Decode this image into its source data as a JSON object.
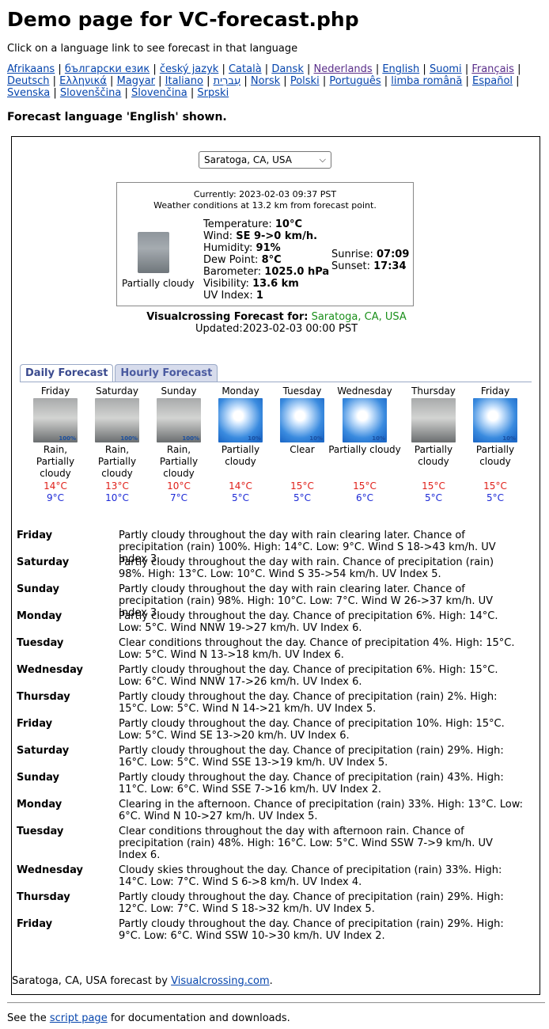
{
  "page": {
    "title": "Demo page for VC-forecast.php",
    "intro": "Click on a language link to see forecast in that language",
    "shown": "Forecast language 'English' shown."
  },
  "languages": [
    "Afrikaans",
    "български език",
    "český jazyk",
    "Català",
    "Dansk",
    "Nederlands",
    "English",
    "Suomi",
    "Français",
    "Deutsch",
    "Ελληνικά",
    "Magyar",
    "Italiano",
    "עִברִית",
    "Norsk",
    "Polski",
    "Português",
    "limba română",
    "Español",
    "Svenska",
    "Slovenščina",
    "Slovenčina",
    "Srpski"
  ],
  "location_select": {
    "value": "Saratoga, CA, USA"
  },
  "current": {
    "time_line": "Currently: 2023-02-03 09:37 PST",
    "distance_line": "Weather conditions at 13.2 km from forecast point.",
    "condition": "Partially cloudy",
    "temperature_label": "Temperature:",
    "temperature": "10°C",
    "wind_label": "Wind:",
    "wind": "SE 9->0 km/h.",
    "humidity_label": "Humidity:",
    "humidity": "91%",
    "dewpoint_label": "Dew Point:",
    "dewpoint": "8°C",
    "barometer_label": "Barometer:",
    "barometer": "1025.0 hPa",
    "visibility_label": "Visibility:",
    "visibility": "13.6 km",
    "uv_label": "UV Index:",
    "uv": "1",
    "sunrise_label": "Sunrise:",
    "sunrise": "07:09",
    "sunset_label": "Sunset:",
    "sunset": "17:34"
  },
  "forecast_for": {
    "label": "Visualcrossing Forecast for:",
    "location": "Saratoga, CA, USA",
    "updated": "Updated:2023-02-03 00:00 PST"
  },
  "tabs": {
    "daily": "Daily Forecast",
    "hourly": "Hourly Forecast"
  },
  "days": [
    {
      "name": "Friday",
      "icon": "rain-icon",
      "pct": "100%",
      "cond": "Rain, Partially cloudy",
      "hi": "14°C",
      "lo": "9°C"
    },
    {
      "name": "Saturday",
      "icon": "rain-icon",
      "pct": "100%",
      "cond": "Rain, Partially cloudy",
      "hi": "13°C",
      "lo": "10°C"
    },
    {
      "name": "Sunday",
      "icon": "rain-icon",
      "pct": "100%",
      "cond": "Rain, Partially cloudy",
      "hi": "10°C",
      "lo": "7°C"
    },
    {
      "name": "Monday",
      "icon": "sun-icon",
      "pct": "10%",
      "cond": "Partially cloudy",
      "hi": "14°C",
      "lo": "5°C"
    },
    {
      "name": "Tuesday",
      "icon": "sun-icon",
      "pct": "10%",
      "cond": "Clear",
      "hi": "15°C",
      "lo": "5°C"
    },
    {
      "name": "Wednesday",
      "icon": "sun-icon",
      "pct": "10%",
      "cond": "Partially cloudy",
      "hi": "15°C",
      "lo": "6°C"
    },
    {
      "name": "Thursday",
      "icon": "rain-icon",
      "pct": "",
      "cond": "Partially cloudy",
      "hi": "15°C",
      "lo": "5°C"
    },
    {
      "name": "Friday",
      "icon": "sun-icon",
      "pct": "10%",
      "cond": "Partially cloudy",
      "hi": "15°C",
      "lo": "5°C"
    }
  ],
  "details": [
    {
      "day": "Friday",
      "text": "Partly cloudy throughout the day with rain clearing later. Chance of precipitation (rain) 100%. High: 14°C. Low: 9°C. Wind S 18->43 km/h. UV Index 3."
    },
    {
      "day": "Saturday",
      "text": "Partly cloudy throughout the day with rain. Chance of precipitation (rain) 98%. High: 13°C. Low: 10°C. Wind S 35->54 km/h. UV Index 5."
    },
    {
      "day": "Sunday",
      "text": "Partly cloudy throughout the day with rain clearing later. Chance of precipitation (rain) 98%. High: 10°C. Low: 7°C. Wind W 26->37 km/h. UV Index 3."
    },
    {
      "day": "Monday",
      "text": "Partly cloudy throughout the day. Chance of precipitation 6%. High: 14°C. Low: 5°C. Wind NNW 19->27 km/h. UV Index 6."
    },
    {
      "day": "Tuesday",
      "text": "Clear conditions throughout the day. Chance of precipitation 4%. High: 15°C. Low: 5°C. Wind N 13->18 km/h. UV Index 6."
    },
    {
      "day": "Wednesday",
      "text": "Partly cloudy throughout the day. Chance of precipitation 6%. High: 15°C. Low: 6°C. Wind NNW 17->26 km/h. UV Index 6."
    },
    {
      "day": "Thursday",
      "text": "Partly cloudy throughout the day. Chance of precipitation (rain) 2%. High: 15°C. Low: 5°C. Wind N 14->21 km/h. UV Index 5."
    },
    {
      "day": "Friday",
      "text": "Partly cloudy throughout the day. Chance of precipitation 10%. High: 15°C. Low: 5°C. Wind SE 13->20 km/h. UV Index 6."
    },
    {
      "day": "Saturday",
      "text": "Partly cloudy throughout the day. Chance of precipitation (rain) 29%. High: 16°C. Low: 5°C. Wind SSE 13->19 km/h. UV Index 5."
    },
    {
      "day": "Sunday",
      "text": "Partly cloudy throughout the day. Chance of precipitation (rain) 43%. High: 11°C. Low: 6°C. Wind SSE 7->16 km/h. UV Index 2."
    },
    {
      "day": "Monday",
      "text": "Clearing in the afternoon. Chance of precipitation (rain) 33%. High: 13°C. Low: 6°C. Wind N 10->27 km/h. UV Index 5."
    },
    {
      "day": "Tuesday",
      "text": "Clear conditions throughout the day with afternoon rain. Chance of precipitation (rain) 48%. High: 16°C. Low: 5°C. Wind SSW 7->9 km/h. UV Index 6."
    },
    {
      "day": "Wednesday",
      "text": "Cloudy skies throughout the day. Chance of precipitation (rain) 33%. High: 14°C. Low: 7°C. Wind S 6->8 km/h. UV Index 4."
    },
    {
      "day": "Thursday",
      "text": "Partly cloudy throughout the day. Chance of precipitation (rain) 29%. High: 12°C. Low: 7°C. Wind S 18->32 km/h. UV Index 5."
    },
    {
      "day": "Friday",
      "text": "Partly cloudy throughout the day. Chance of precipitation (rain) 29%. High: 9°C. Low: 6°C. Wind SSW 10->30 km/h. UV Index 2."
    }
  ],
  "credit": {
    "prefix": "Saratoga, CA, USA forecast by ",
    "link": "Visualcrossing.com",
    "suffix": "."
  },
  "footer": {
    "prefix": "See the ",
    "link": "script page",
    "suffix": " for documentation and downloads."
  }
}
